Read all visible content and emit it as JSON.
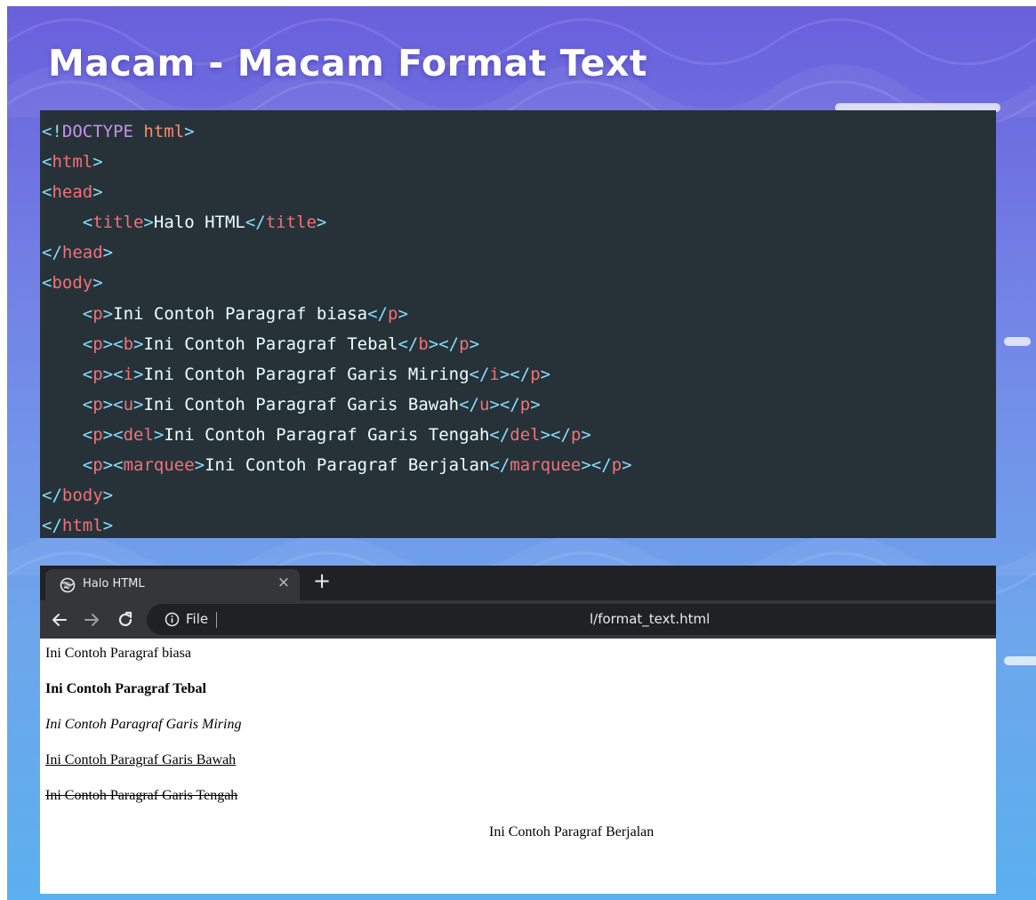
{
  "slide": {
    "title": "Macam - Macam Format Text"
  },
  "code": {
    "lines": [
      [
        {
          "t": "<!",
          "c": "pn"
        },
        {
          "t": "DOCTYPE",
          "c": "kw"
        },
        {
          "t": " html",
          "c": "at"
        },
        {
          "t": ">",
          "c": "pn"
        }
      ],
      [
        {
          "t": "<",
          "c": "pn"
        },
        {
          "t": "html",
          "c": "tg"
        },
        {
          "t": ">",
          "c": "pn"
        }
      ],
      [
        {
          "t": "<",
          "c": "pn"
        },
        {
          "t": "head",
          "c": "tg"
        },
        {
          "t": ">",
          "c": "pn"
        }
      ],
      [
        {
          "t": "    ",
          "c": "tx"
        },
        {
          "t": "<",
          "c": "pn"
        },
        {
          "t": "title",
          "c": "tg"
        },
        {
          "t": ">",
          "c": "pn"
        },
        {
          "t": "Halo HTML",
          "c": "tx"
        },
        {
          "t": "</",
          "c": "pn"
        },
        {
          "t": "title",
          "c": "tg"
        },
        {
          "t": ">",
          "c": "pn"
        }
      ],
      [
        {
          "t": "</",
          "c": "pn"
        },
        {
          "t": "head",
          "c": "tg"
        },
        {
          "t": ">",
          "c": "pn"
        }
      ],
      [
        {
          "t": "<",
          "c": "pn"
        },
        {
          "t": "body",
          "c": "tg"
        },
        {
          "t": ">",
          "c": "pn"
        }
      ],
      [
        {
          "t": "    ",
          "c": "tx"
        },
        {
          "t": "<",
          "c": "pn"
        },
        {
          "t": "p",
          "c": "tg"
        },
        {
          "t": ">",
          "c": "pn"
        },
        {
          "t": "Ini Contoh Paragraf biasa",
          "c": "tx"
        },
        {
          "t": "</",
          "c": "pn"
        },
        {
          "t": "p",
          "c": "tg"
        },
        {
          "t": ">",
          "c": "pn"
        }
      ],
      [
        {
          "t": "    ",
          "c": "tx"
        },
        {
          "t": "<",
          "c": "pn"
        },
        {
          "t": "p",
          "c": "tg"
        },
        {
          "t": "><",
          "c": "pn"
        },
        {
          "t": "b",
          "c": "tg"
        },
        {
          "t": ">",
          "c": "pn"
        },
        {
          "t": "Ini Contoh Paragraf Tebal",
          "c": "tx"
        },
        {
          "t": "</",
          "c": "pn"
        },
        {
          "t": "b",
          "c": "tg"
        },
        {
          "t": "></",
          "c": "pn"
        },
        {
          "t": "p",
          "c": "tg"
        },
        {
          "t": ">",
          "c": "pn"
        }
      ],
      [
        {
          "t": "    ",
          "c": "tx"
        },
        {
          "t": "<",
          "c": "pn"
        },
        {
          "t": "p",
          "c": "tg"
        },
        {
          "t": "><",
          "c": "pn"
        },
        {
          "t": "i",
          "c": "tg"
        },
        {
          "t": ">",
          "c": "pn"
        },
        {
          "t": "Ini Contoh Paragraf Garis Miring",
          "c": "tx"
        },
        {
          "t": "</",
          "c": "pn"
        },
        {
          "t": "i",
          "c": "tg"
        },
        {
          "t": "></",
          "c": "pn"
        },
        {
          "t": "p",
          "c": "tg"
        },
        {
          "t": ">",
          "c": "pn"
        }
      ],
      [
        {
          "t": "    ",
          "c": "tx"
        },
        {
          "t": "<",
          "c": "pn"
        },
        {
          "t": "p",
          "c": "tg"
        },
        {
          "t": "><",
          "c": "pn"
        },
        {
          "t": "u",
          "c": "tg"
        },
        {
          "t": ">",
          "c": "pn"
        },
        {
          "t": "Ini Contoh Paragraf Garis Bawah",
          "c": "tx"
        },
        {
          "t": "</",
          "c": "pn"
        },
        {
          "t": "u",
          "c": "tg"
        },
        {
          "t": "></",
          "c": "pn"
        },
        {
          "t": "p",
          "c": "tg"
        },
        {
          "t": ">",
          "c": "pn"
        }
      ],
      [
        {
          "t": "    ",
          "c": "tx"
        },
        {
          "t": "<",
          "c": "pn"
        },
        {
          "t": "p",
          "c": "tg"
        },
        {
          "t": "><",
          "c": "pn"
        },
        {
          "t": "del",
          "c": "tg"
        },
        {
          "t": ">",
          "c": "pn"
        },
        {
          "t": "Ini Contoh Paragraf Garis Tengah",
          "c": "tx"
        },
        {
          "t": "</",
          "c": "pn"
        },
        {
          "t": "del",
          "c": "tg"
        },
        {
          "t": "></",
          "c": "pn"
        },
        {
          "t": "p",
          "c": "tg"
        },
        {
          "t": ">",
          "c": "pn"
        }
      ],
      [
        {
          "t": "    ",
          "c": "tx"
        },
        {
          "t": "<",
          "c": "pn"
        },
        {
          "t": "p",
          "c": "tg"
        },
        {
          "t": "><",
          "c": "pn"
        },
        {
          "t": "marquee",
          "c": "tg"
        },
        {
          "t": ">",
          "c": "pn"
        },
        {
          "t": "Ini Contoh Paragraf Berjalan",
          "c": "tx"
        },
        {
          "t": "</",
          "c": "pn"
        },
        {
          "t": "marquee",
          "c": "tg"
        },
        {
          "t": "></",
          "c": "pn"
        },
        {
          "t": "p",
          "c": "tg"
        },
        {
          "t": ">",
          "c": "pn"
        }
      ],
      [
        {
          "t": "</",
          "c": "pn"
        },
        {
          "t": "body",
          "c": "tg"
        },
        {
          "t": ">",
          "c": "pn"
        }
      ],
      [
        {
          "t": "</",
          "c": "pn"
        },
        {
          "t": "html",
          "c": "tg"
        },
        {
          "t": ">",
          "c": "pn"
        }
      ]
    ]
  },
  "browser": {
    "tab": {
      "favicon": "globe-icon",
      "title": "Halo HTML",
      "close": "×"
    },
    "new_tab": "+",
    "toolbar": {
      "back_icon": "arrow-left-icon",
      "forward_icon": "arrow-right-icon",
      "reload_icon": "reload-icon",
      "info_icon": "info-icon",
      "site_chip": "File",
      "url": "l/format_text.html"
    },
    "content": {
      "normal": "Ini Contoh Paragraf biasa",
      "bold": "Ini Contoh Paragraf Tebal",
      "italic": "Ini Contoh Paragraf Garis Miring",
      "underline": "Ini Contoh Paragraf Garis Bawah",
      "strike": "Ini Contoh Paragraf Garis Tengah",
      "marquee": "Ini Contoh Paragraf Berjalan"
    }
  },
  "colors": {
    "code_background": "#263238",
    "code_punctuation": "#89ddff",
    "code_tag": "#f07178",
    "code_keyword": "#c792ea",
    "code_attribute": "#f78c6c",
    "code_text": "#eeffff",
    "browser_tabbar": "#202124",
    "browser_toolbar": "#35363a"
  }
}
